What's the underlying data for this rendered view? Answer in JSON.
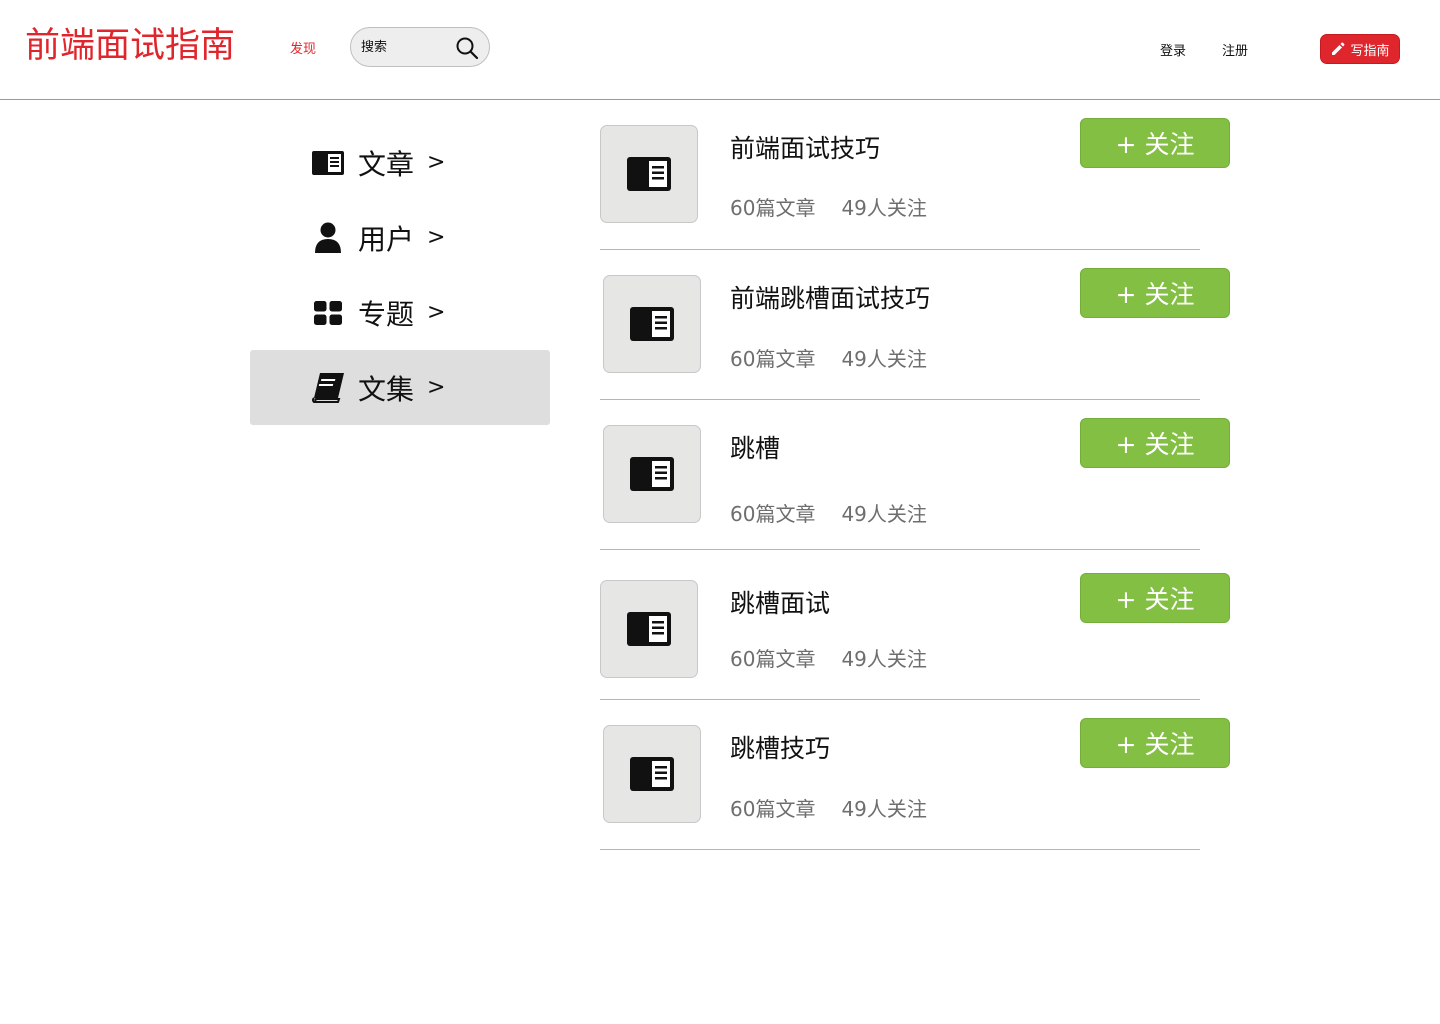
{
  "header": {
    "logo": "前端面试指南",
    "nav_discover": "发现",
    "search_placeholder": "搜索",
    "login": "登录",
    "register": "注册",
    "write_button": "写指南"
  },
  "sidebar": {
    "items": [
      {
        "label": "文章",
        "arrow": ">",
        "icon": "article-icon",
        "active": false
      },
      {
        "label": "用户",
        "arrow": ">",
        "icon": "user-icon",
        "active": false
      },
      {
        "label": "专题",
        "arrow": ">",
        "icon": "grid-icon",
        "active": false
      },
      {
        "label": "文集",
        "arrow": ">",
        "icon": "book-icon",
        "active": true
      }
    ]
  },
  "collections": [
    {
      "title": "前端面试技巧",
      "articles": "60篇文章",
      "followers": "49人关注",
      "follow": "+ 关注"
    },
    {
      "title": "前端跳槽面试技巧",
      "articles": "60篇文章",
      "followers": "49人关注",
      "follow": "+ 关注"
    },
    {
      "title": "跳槽",
      "articles": "60篇文章",
      "followers": "49人关注",
      "follow": "+ 关注"
    },
    {
      "title": "跳槽面试",
      "articles": "60篇文章",
      "followers": "49人关注",
      "follow": "+ 关注"
    },
    {
      "title": "跳槽技巧",
      "articles": "60篇文章",
      "followers": "49人关注",
      "follow": "+ 关注"
    }
  ],
  "colors": {
    "brand_red": "#e0262d",
    "follow_green": "#82bf43",
    "active_bg": "#dedede"
  }
}
